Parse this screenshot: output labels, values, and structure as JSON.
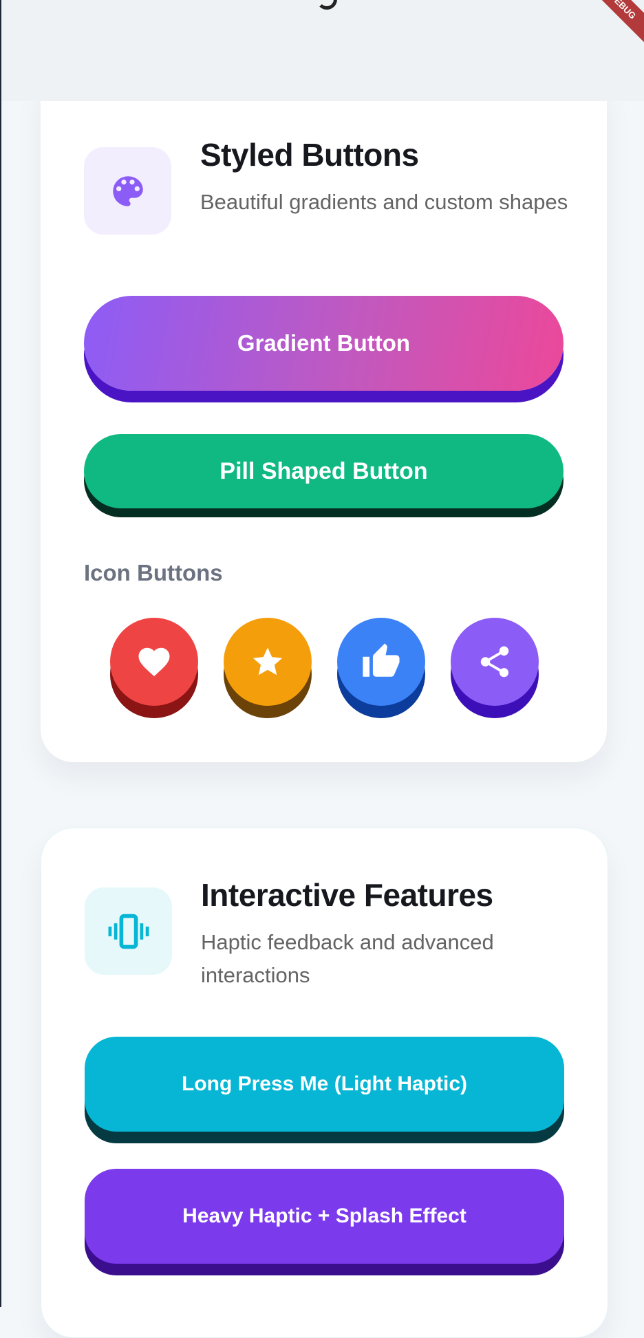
{
  "debug_banner": "DEBUG",
  "styled_card": {
    "icon": "palette-icon",
    "title": "Styled Buttons",
    "subtitle": "Beautiful gradients and custom shapes",
    "gradient_button": "Gradient Button",
    "pill_button": "Pill Shaped Button",
    "icon_section_label": "Icon Buttons",
    "icon_buttons": [
      {
        "icon": "heart-icon",
        "color": "#ef4444"
      },
      {
        "icon": "star-icon",
        "color": "#f59e0b"
      },
      {
        "icon": "thumbs-up-icon",
        "color": "#3b82f6"
      },
      {
        "icon": "share-icon",
        "color": "#8b5cf6"
      }
    ]
  },
  "interactive_card": {
    "icon": "vibration-icon",
    "title": "Interactive Features",
    "subtitle": "Haptic feedback and advanced interactions",
    "long_press_button": "Long Press Me (Light Haptic)",
    "heavy_haptic_button": "Heavy Haptic + Splash Effect"
  },
  "colors": {
    "gradient_start": "#8b5cf6",
    "gradient_end": "#ec4899",
    "pill_green": "#10b981",
    "cyan": "#06b6d4",
    "violet": "#7c3aed"
  }
}
